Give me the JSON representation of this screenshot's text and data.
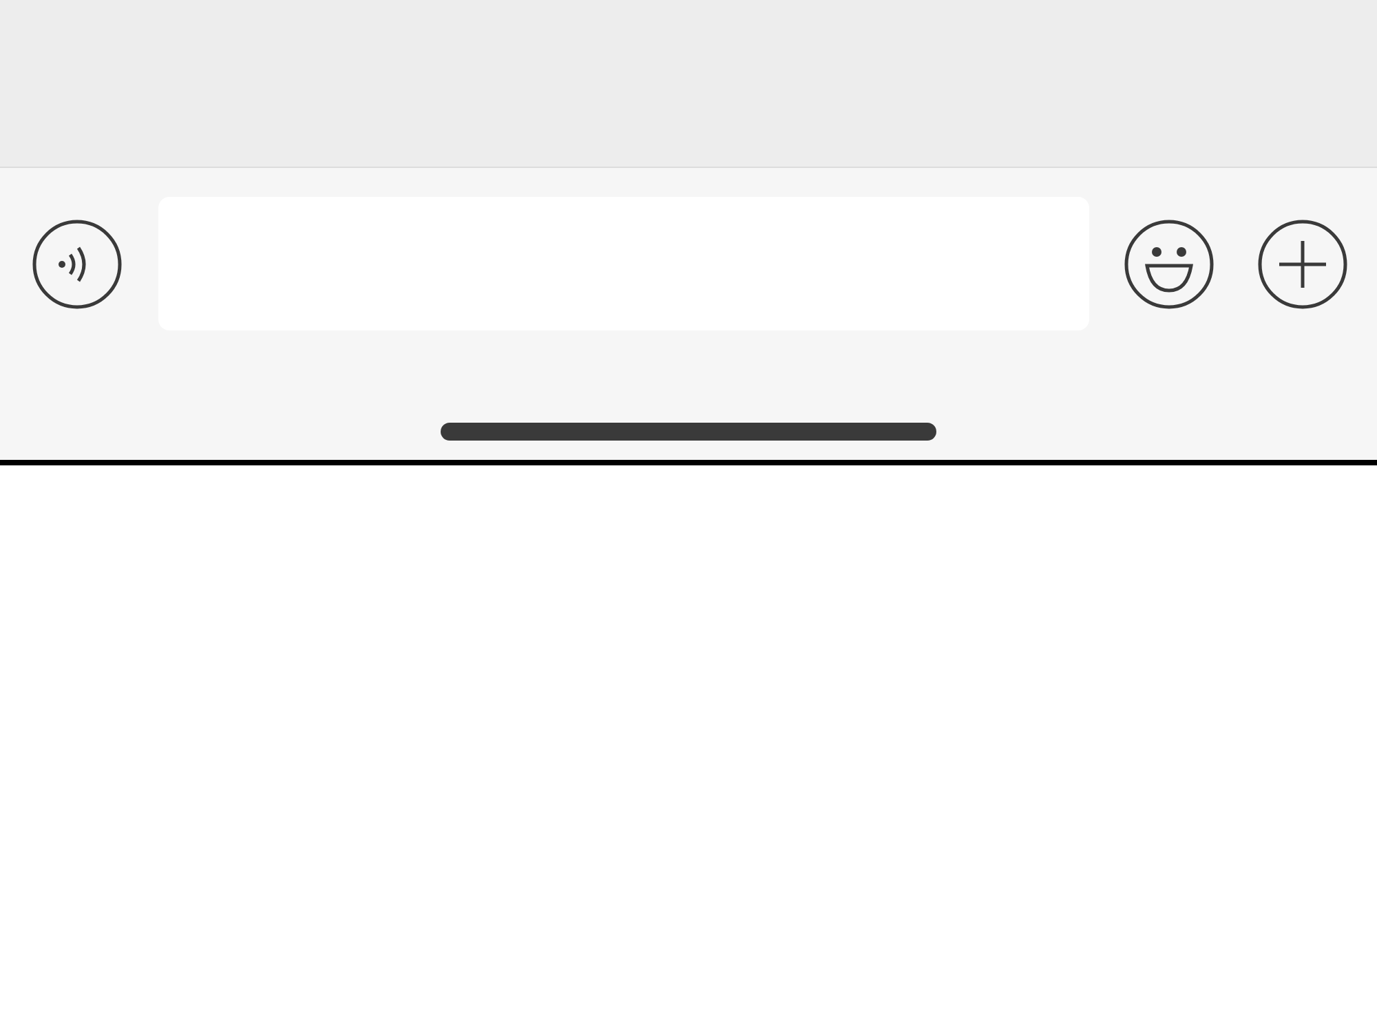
{
  "input_bar": {
    "items": [
      {
        "kind": "voice"
      },
      {
        "kind": "field"
      },
      {
        "kind": "emoji"
      },
      {
        "kind": "add"
      }
    ]
  }
}
